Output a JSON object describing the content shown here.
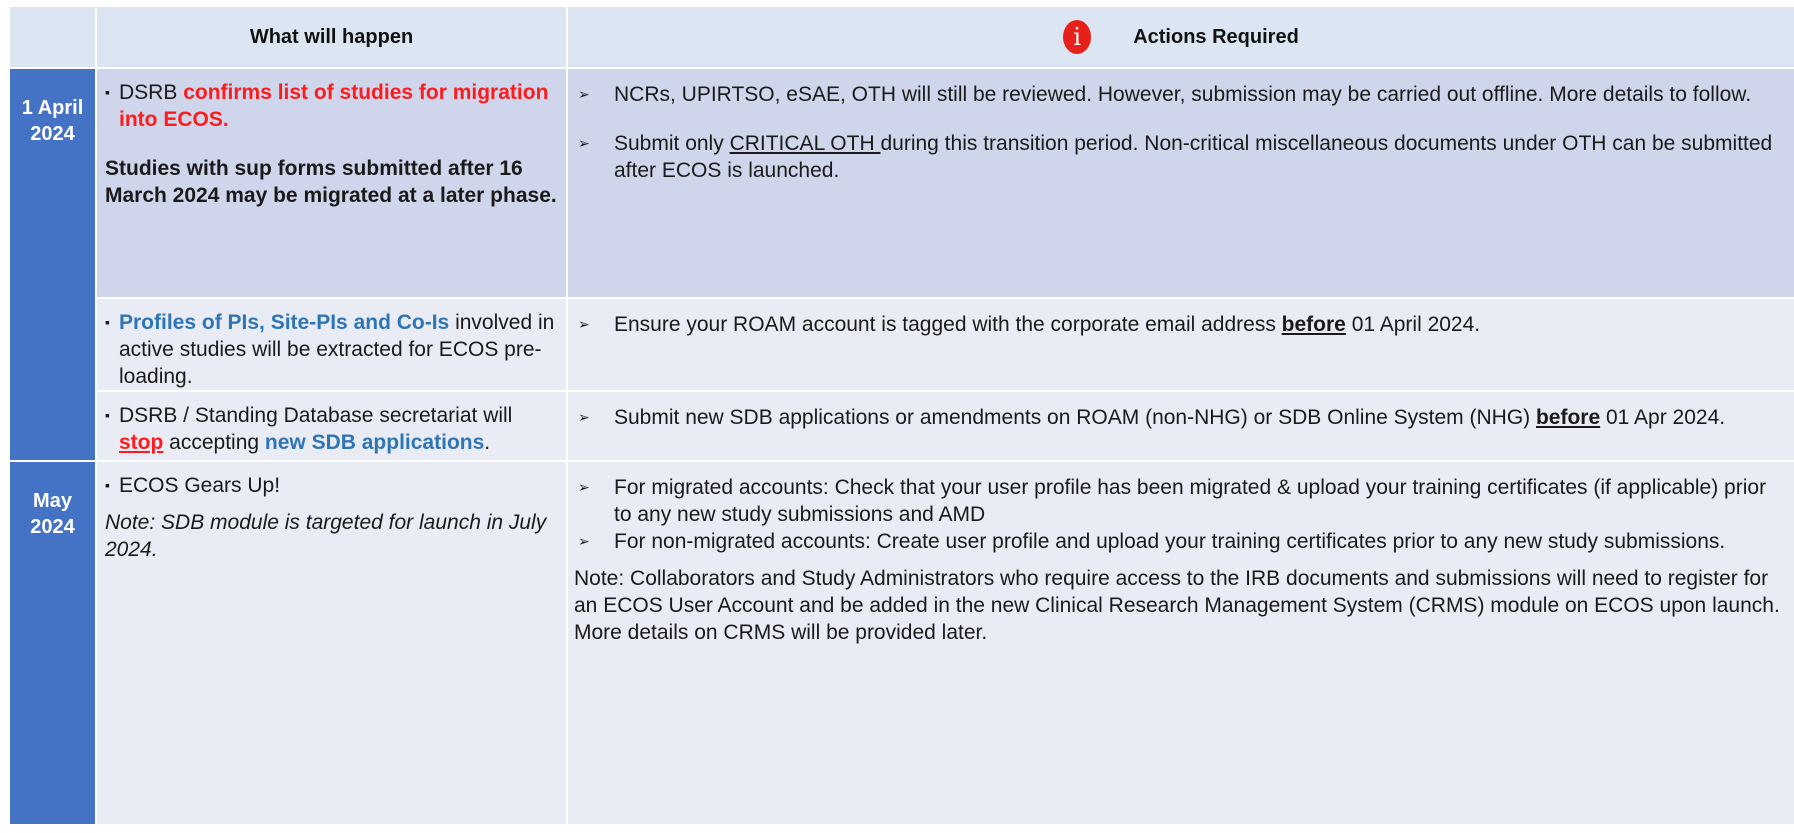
{
  "header": {
    "what_label": "What will happen",
    "actions_label": "Actions Required",
    "info_icon": "i"
  },
  "rows": [
    {
      "date": "1 April 2024",
      "what": {
        "prefix": "DSRB ",
        "highlight": "confirms list of studies for migration into ECOS.",
        "note": "Studies with sup forms submitted after 16 March 2024 may be migrated at a later phase."
      },
      "actions": [
        "NCRs, UPIRTSO, eSAE, OTH will still be reviewed. However, submission may be carried out offline. More details to follow.",
        {
          "pre": "Submit only ",
          "underlined": "CRITICAL OTH ",
          "post": "during this transition period. Non-critical miscellaneous documents under OTH can be submitted after ECOS is launched."
        }
      ]
    },
    {
      "what": {
        "highlight": "Profiles of PIs, Site-PIs and Co-Is",
        "rest": " involved in active studies will be extracted for ECOS pre-loading."
      },
      "actions": [
        {
          "pre": "Ensure your ROAM account is tagged with the corporate email address ",
          "underlined": "before",
          "post": " 01 April 2024."
        }
      ]
    },
    {
      "what": {
        "prefix": "DSRB / Standing Database secretariat will ",
        "stop": "stop",
        "mid": " accepting ",
        "highlight": "new SDB applications",
        "end": "."
      },
      "actions": [
        {
          "pre": "Submit new SDB applications or amendments on ROAM (non-NHG) or SDB Online System (NHG) ",
          "underlined": "before",
          "post": " 01 Apr 2024."
        }
      ]
    },
    {
      "date": "May 2024",
      "what": {
        "item": "ECOS Gears Up!",
        "note": "Note: SDB module is targeted for launch in July 2024."
      },
      "actions": [
        "For migrated accounts: Check that your user profile has been migrated & upload your training certificates (if applicable) prior to any new study submissions and AMD",
        "For non-migrated accounts: Create user profile and upload your training certificates prior to any new study submissions."
      ],
      "actions_note": "Note: Collaborators and Study Administrators who require access to the IRB documents and submissions will need to register for an ECOS User Account and be added in the new Clinical Research Management System (CRMS) module on ECOS upon launch. More details on CRMS will be provided later."
    }
  ]
}
